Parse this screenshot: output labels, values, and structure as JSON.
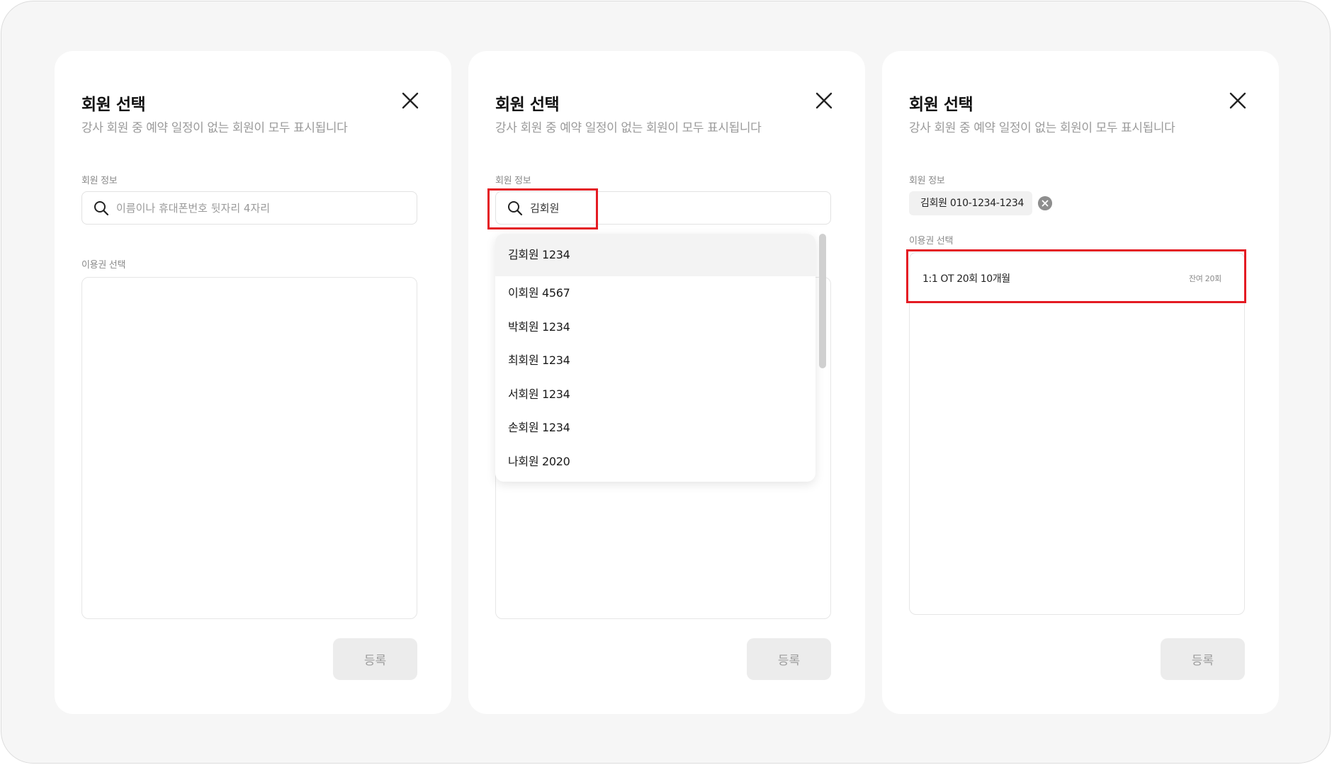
{
  "common": {
    "title": "회원 선택",
    "subtitle": "강사 회원 중 예약 일정이 없는 회원이 모두 표시됩니다",
    "member_info_label": "회원 정보",
    "pass_select_label": "이용권 선택",
    "submit_label": "등록"
  },
  "panel1": {
    "search_placeholder": "이름이나 휴대폰번호 뒷자리 4자리"
  },
  "panel2": {
    "search_value": "김회원",
    "results": [
      "김회원 1234",
      "이회원 4567",
      "박회원 1234",
      "최회원 1234",
      "서회원 1234",
      "손회원 1234",
      "나회원 2020"
    ]
  },
  "panel3": {
    "selected_member": "김회원 010-1234-1234",
    "passes": [
      {
        "name": "1:1 OT 20회 10개월",
        "remaining": "잔여 20회"
      }
    ]
  },
  "colors": {
    "highlight": "#e41b23",
    "background": "#f6f6f6"
  }
}
